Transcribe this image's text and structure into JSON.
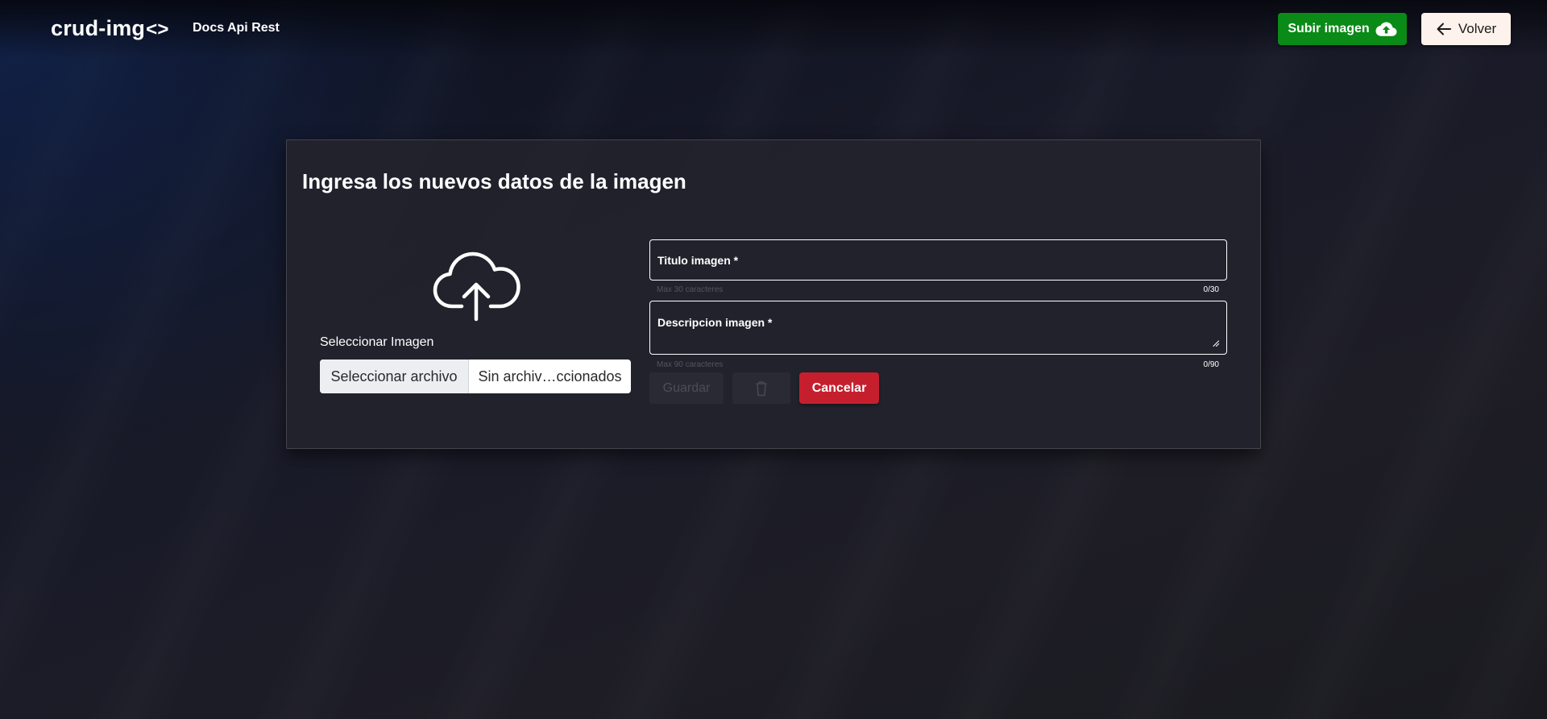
{
  "header": {
    "logo_text": "crud-img",
    "logo_glyph": "<>",
    "nav_docs": "Docs Api Rest",
    "upload_button": "Subir imagen",
    "upload_icon": "cloud-upload-icon",
    "back_button": "Volver",
    "back_icon": "arrow-left-icon"
  },
  "form": {
    "title": "Ingresa los nuevos datos de la imagen",
    "upload_icon": "cloud-upload-icon",
    "select_label": "Seleccionar Imagen",
    "file_button": "Seleccionar archivo",
    "file_status": "Sin archiv…ccionados",
    "title_field": {
      "label": "Titulo imagen *",
      "helper": "Max 30 caracteres",
      "counter": "0/30"
    },
    "description_field": {
      "label": "Descripcion imagen *",
      "helper": "Max 90 caracteres",
      "counter": "0/90"
    },
    "save_button": "Guardar",
    "delete_icon": "trash-icon",
    "cancel_button": "Cancelar"
  },
  "colors": {
    "upload_button_bg": "#0a8a16",
    "back_button_bg": "#fdf2ec",
    "cancel_button_bg": "#c51f2e",
    "card_bg": "#23232c"
  }
}
